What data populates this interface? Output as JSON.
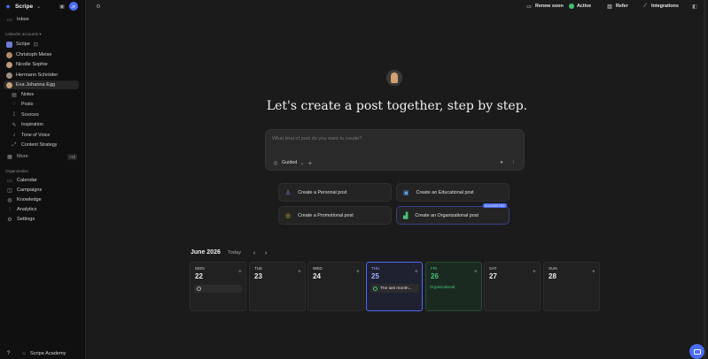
{
  "sidebar": {
    "workspace": "Scripe",
    "user_initials": "JF",
    "inbox": "Inbox",
    "linkedin_section": "LinkedIn accounts",
    "accounts": [
      {
        "name": "Scripe",
        "color": "#6c7ad6"
      },
      {
        "name": "Christoph Meise",
        "color": "#b08a6a"
      },
      {
        "name": "Nicolle Sophie",
        "color": "#c49a7a"
      },
      {
        "name": "Hermann Schröder",
        "color": "#9c8f80"
      },
      {
        "name": "Eva Johanna Egg",
        "color": "#c9a07c"
      }
    ],
    "sub_items": [
      "Notes",
      "Posts",
      "Sources",
      "Inspiration",
      "Tone of Voice",
      "Content Strategy"
    ],
    "more": "More",
    "more_count": "+10",
    "org_section": "Organization",
    "org_items": [
      "Calendar",
      "Campaigns",
      "Knowledge",
      "Analytics",
      "Settings"
    ],
    "help": "?",
    "academy": "Scripe Academy"
  },
  "topbar": {
    "renew": "Renew soon",
    "active": "Active",
    "refer": "Refer",
    "integrations": "Integrations"
  },
  "hero": {
    "title": "Let's create a post together, step by step."
  },
  "prompt": {
    "placeholder": "What kind of post do you want to create?",
    "mode": "Guided"
  },
  "cards": [
    {
      "label": "Create a Personal post",
      "icon": "♙",
      "color": "#8f7ad6"
    },
    {
      "label": "Create an Educational post",
      "icon": "▣",
      "color": "#5aa0e6"
    },
    {
      "label": "Create a Promotional post",
      "icon": "◎",
      "color": "#e6b84a"
    },
    {
      "label": "Create an Organizational post",
      "icon": "▟",
      "color": "#48c07a",
      "badge": "SUGGESTED"
    }
  ],
  "calendar": {
    "month": "June 2026",
    "today": "Today",
    "days": [
      {
        "dow": "MON",
        "num": "22"
      },
      {
        "dow": "TUE",
        "num": "23"
      },
      {
        "dow": "WED",
        "num": "24"
      },
      {
        "dow": "THU",
        "num": "25",
        "event": "The last month..."
      },
      {
        "dow": "FRI",
        "num": "26",
        "tag": "Organizational"
      },
      {
        "dow": "SAT",
        "num": "27"
      },
      {
        "dow": "SUN",
        "num": "28"
      }
    ]
  },
  "colors": {
    "accent_blue": "#4a6cf7",
    "green": "#48c07a"
  }
}
